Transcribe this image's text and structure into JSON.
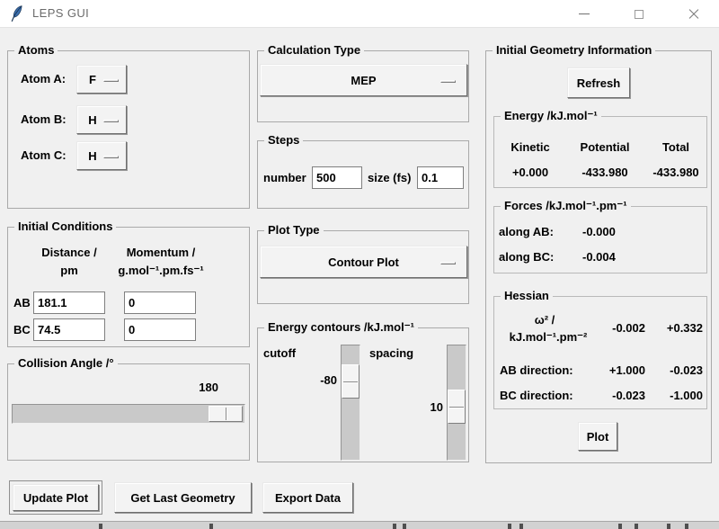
{
  "window": {
    "title": "LEPS GUI"
  },
  "colors": {
    "window_bg": "#f0f0f0",
    "titlebar_bg": "#ffffff",
    "feather_blue": "#3c6fae"
  },
  "atoms": {
    "title": "Atoms",
    "rows": [
      {
        "label": "Atom A:",
        "value": "F"
      },
      {
        "label": "Atom B:",
        "value": "H"
      },
      {
        "label": "Atom C:",
        "value": "H"
      }
    ]
  },
  "ic": {
    "title": "Initial Conditions",
    "col1": [
      "Distance /",
      "pm"
    ],
    "col2": [
      "Momentum /",
      "g.mol⁻¹.pm.fs⁻¹"
    ],
    "rows": [
      {
        "label": "AB",
        "distance": "181.1",
        "momentum": "0"
      },
      {
        "label": "BC",
        "distance": "74.5",
        "momentum": "0"
      }
    ]
  },
  "collision": {
    "title": "Collision Angle /°",
    "value": "180"
  },
  "calc": {
    "title": "Calculation Type",
    "selected": "MEP"
  },
  "steps": {
    "title": "Steps",
    "number_label": "number",
    "number_value": "500",
    "size_label": "size (fs)",
    "size_value": "0.1"
  },
  "plot": {
    "title": "Plot Type",
    "selected": "Contour Plot"
  },
  "contours": {
    "title": "Energy contours /kJ.mol⁻¹",
    "cutoff_label": "cutoff",
    "cutoff_value": "-80",
    "spacing_label": "spacing",
    "spacing_value": "10"
  },
  "geo": {
    "title": "Initial Geometry Information",
    "refresh": "Refresh",
    "energy": {
      "title": "Energy /kJ.mol⁻¹",
      "headers": [
        "Kinetic",
        "Potential",
        "Total"
      ],
      "values": [
        "+0.000",
        "-433.980",
        "-433.980"
      ]
    },
    "forces": {
      "title": "Forces /kJ.mol⁻¹.pm⁻¹",
      "rows": [
        {
          "label": "along AB:",
          "value": "-0.000"
        },
        {
          "label": "along BC:",
          "value": "-0.004"
        }
      ]
    },
    "hessian": {
      "title": "Hessian",
      "omega_label": [
        "ω² /",
        "kJ.mol⁻¹.pm⁻²"
      ],
      "omega_values": [
        "-0.002",
        "+0.332"
      ],
      "rows": [
        {
          "label": "AB direction:",
          "values": [
            "+1.000",
            "-0.023"
          ]
        },
        {
          "label": "BC direction:",
          "values": [
            "-0.023",
            "-1.000"
          ]
        }
      ]
    },
    "plot_button": "Plot"
  },
  "buttons": {
    "update": "Update Plot",
    "get_last": "Get Last Geometry",
    "export": "Export Data"
  }
}
